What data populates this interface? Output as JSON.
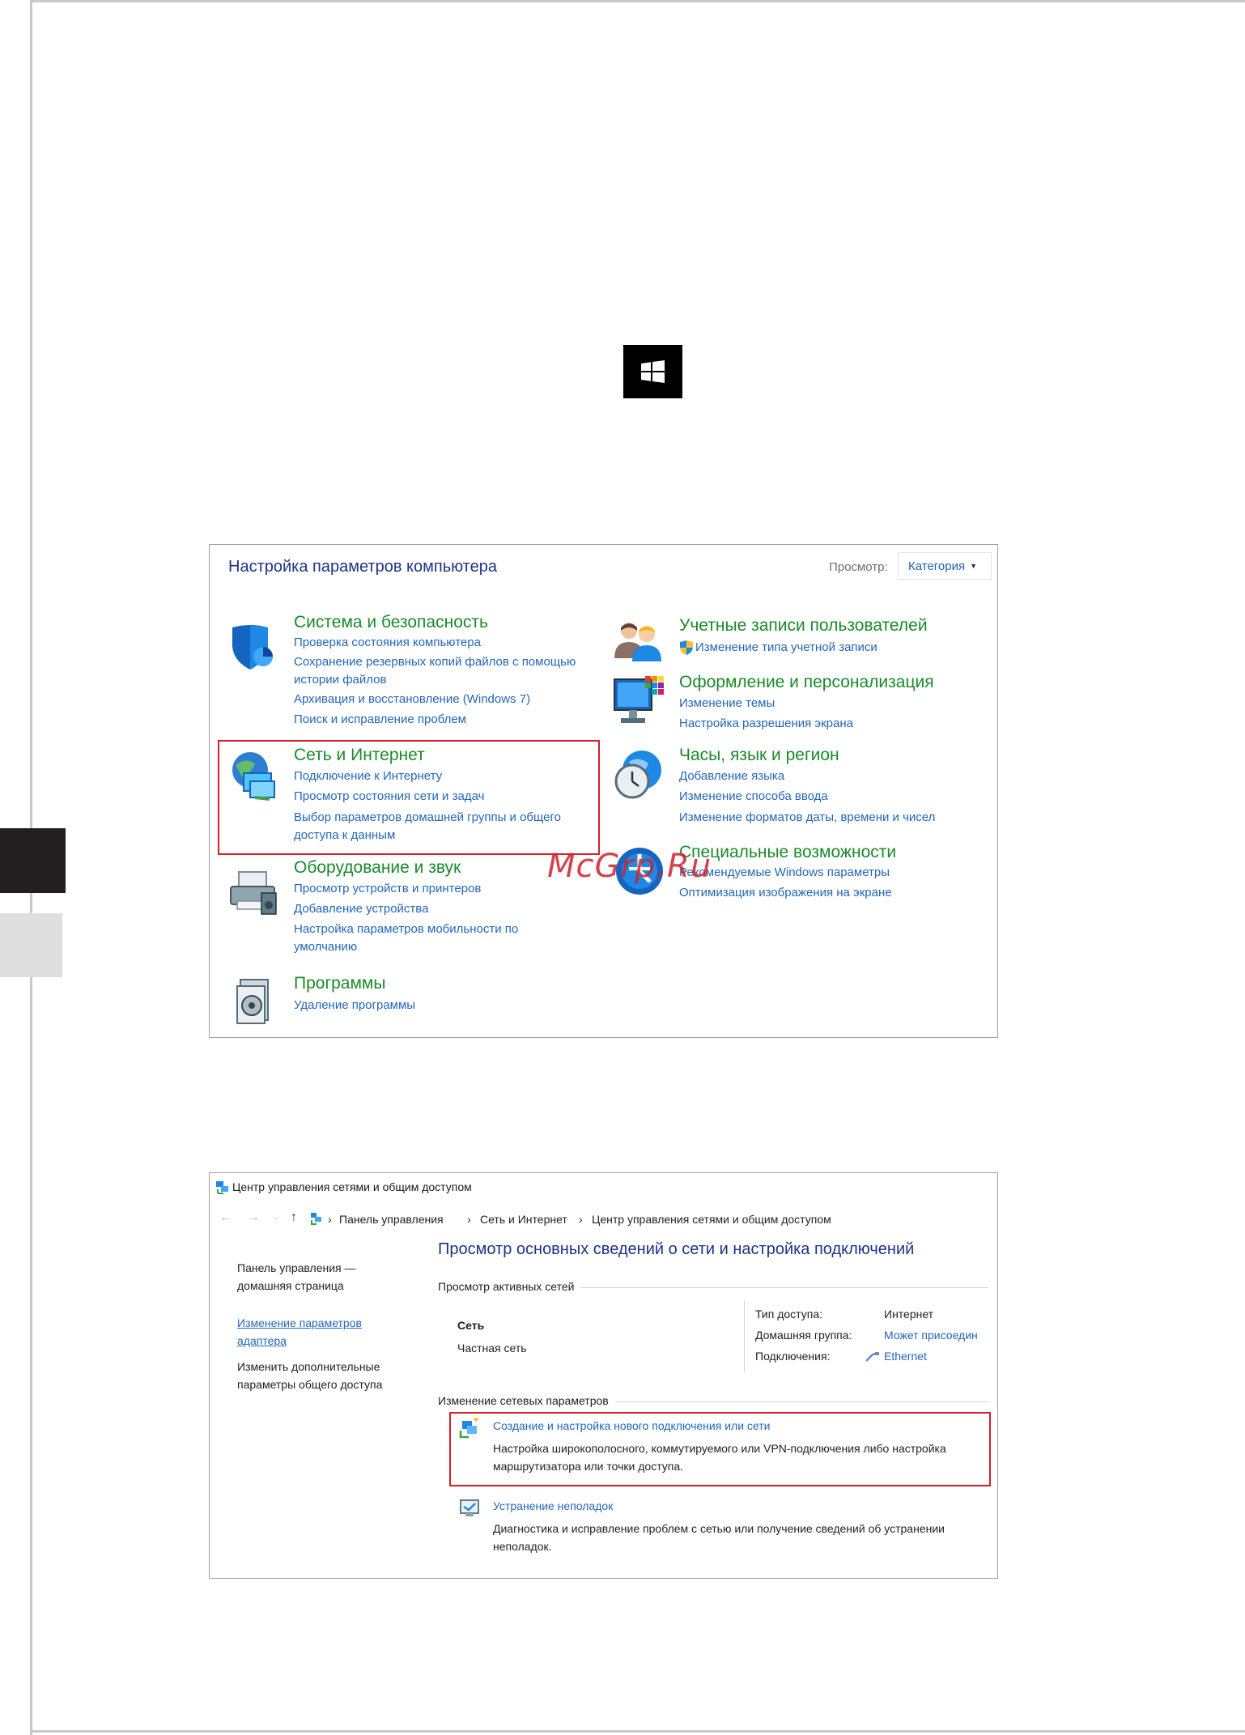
{
  "control_panel": {
    "title": "Настройка параметров компьютера",
    "view_label": "Просмотр:",
    "view_value": "Категория",
    "categories": [
      {
        "title": "Система и безопасность",
        "links": [
          "Проверка состояния компьютера",
          "Сохранение резервных копий файлов с помощью",
          "истории файлов",
          "Архивация и восстановление (Windows 7)",
          "Поиск и исправление проблем"
        ]
      },
      {
        "title": "Сеть и Интернет",
        "links": [
          "Подключение к Интернету",
          "Просмотр состояния сети и задач",
          "Выбор параметров домашней группы и общего",
          "доступа к данным"
        ]
      },
      {
        "title": "Оборудование и звук",
        "links": [
          "Просмотр устройств и принтеров",
          "Добавление устройства",
          "Настройка параметров мобильности по",
          "умолчанию"
        ]
      },
      {
        "title": "Программы",
        "links": [
          "Удаление программы"
        ]
      },
      {
        "title": "Учетные записи пользователей",
        "links": [
          "Изменение типа учетной записи"
        ]
      },
      {
        "title": "Оформление и персонализация",
        "links": [
          "Изменение темы",
          "Настройка разрешения экрана"
        ]
      },
      {
        "title": "Часы, язык и регион",
        "links": [
          "Добавление языка",
          "Изменение способа ввода",
          "Изменение форматов даты, времени и чисел"
        ]
      },
      {
        "title": "Специальные возможности",
        "links": [
          "Рекомендуемые Windows параметры",
          "Оптимизация изображения на экране"
        ]
      }
    ]
  },
  "network_center": {
    "window_title": "Центр управления сетями и общим доступом",
    "breadcrumb": [
      "Панель управления",
      "Сеть и Интернет",
      "Центр управления сетями и общим доступом"
    ],
    "sidebar": [
      "Панель управления —",
      "домашняя страница",
      "Изменение параметров",
      "адаптера",
      "Изменить дополнительные",
      "параметры общего доступа"
    ],
    "heading": "Просмотр основных сведений о сети и настройка подключений",
    "active_networks_label": "Просмотр активных сетей",
    "network_name": "Сеть",
    "network_type": "Частная сеть",
    "access_type_label": "Тип доступа:",
    "access_type_value": "Интернет",
    "homegroup_label": "Домашняя группа:",
    "homegroup_value": "Может присоедин",
    "connections_label": "Подключения:",
    "connections_value": "Ethernet",
    "change_settings_label": "Изменение сетевых параметров",
    "tasks": [
      {
        "title": "Создание и настройка нового подключения или сети",
        "desc": [
          "Настройка широкополосного, коммутируемого или VPN-подключения либо настройка",
          "маршрутизатора или точки доступа."
        ]
      },
      {
        "title": "Устранение неполадок",
        "desc": [
          "Диагностика и исправление проблем с сетью или получение сведений об устранении",
          "неполадок."
        ]
      }
    ]
  },
  "watermark": "McGrp.Ru",
  "colors": {
    "link": "#2366b9",
    "category_title": "#1a8a2a",
    "heading": "#1e3287",
    "highlight": "#d0212b"
  }
}
